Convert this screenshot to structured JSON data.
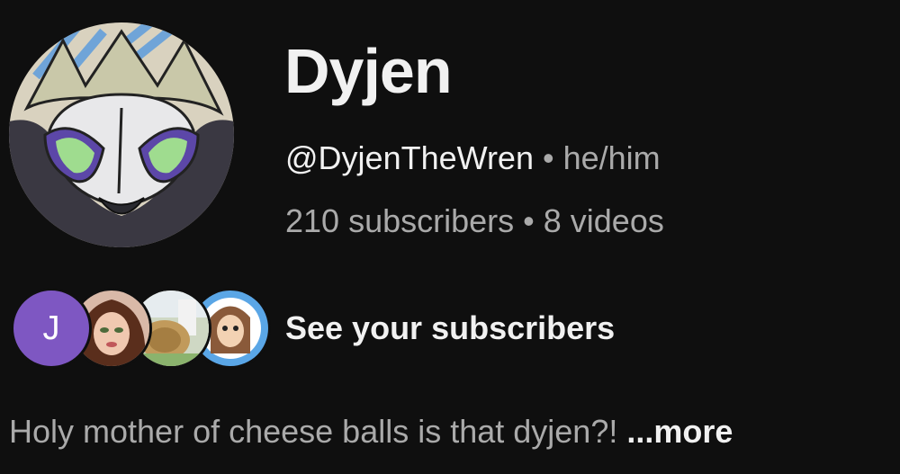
{
  "channel": {
    "name": "Dyjen",
    "handle": "@DyjenTheWren",
    "separator": "•",
    "pronouns": "he/him",
    "subscribers": "210 subscribers",
    "videos": "8 videos",
    "avatar_icon": "creature-avatar-image"
  },
  "subscribers_preview": {
    "first_initial": "J",
    "first_color": "#7e57c2",
    "label": "See your subscribers"
  },
  "description": {
    "text": "Holy mother of cheese balls is that dyjen?!",
    "more_label": "...more"
  },
  "colors": {
    "background": "#0f0f0f",
    "primary_text": "#f1f1f1",
    "secondary_text": "#aaaaaa"
  }
}
